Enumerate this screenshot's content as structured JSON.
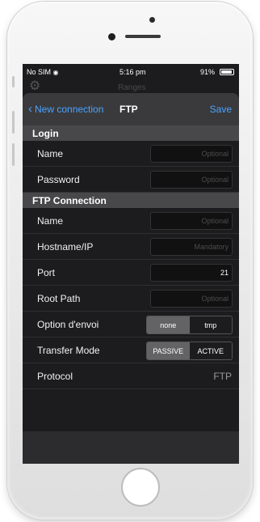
{
  "status_bar": {
    "carrier": "No SIM",
    "time": "5:16 pm",
    "battery": "91%"
  },
  "background_screen": {
    "title": "Ranges"
  },
  "navbar": {
    "back_label": "New connection",
    "title": "FTP",
    "save_label": "Save"
  },
  "sections": {
    "login": {
      "header": "Login",
      "name": {
        "label": "Name",
        "placeholder": "Optional"
      },
      "password": {
        "label": "Password",
        "placeholder": "Optional"
      }
    },
    "ftp": {
      "header": "FTP Connection",
      "name": {
        "label": "Name",
        "placeholder": "Optional"
      },
      "hostname": {
        "label": "Hostname/IP",
        "placeholder": "Mandatory"
      },
      "port": {
        "label": "Port",
        "value": "21"
      },
      "root_path": {
        "label": "Root Path",
        "placeholder": "Optional"
      },
      "send_option": {
        "label": "Option d'envoi",
        "options": [
          "none",
          "tmp"
        ],
        "selected": "none"
      },
      "transfer_mode": {
        "label": "Transfer Mode",
        "options": [
          "PASSIVE",
          "ACTIVE"
        ],
        "selected": "PASSIVE"
      },
      "protocol": {
        "label": "Protocol",
        "value": "FTP"
      }
    }
  },
  "colors": {
    "accent": "#4aa3ff",
    "background": "#1c1c1e",
    "section": "#48484a",
    "navbar": "#3a3a3c"
  }
}
